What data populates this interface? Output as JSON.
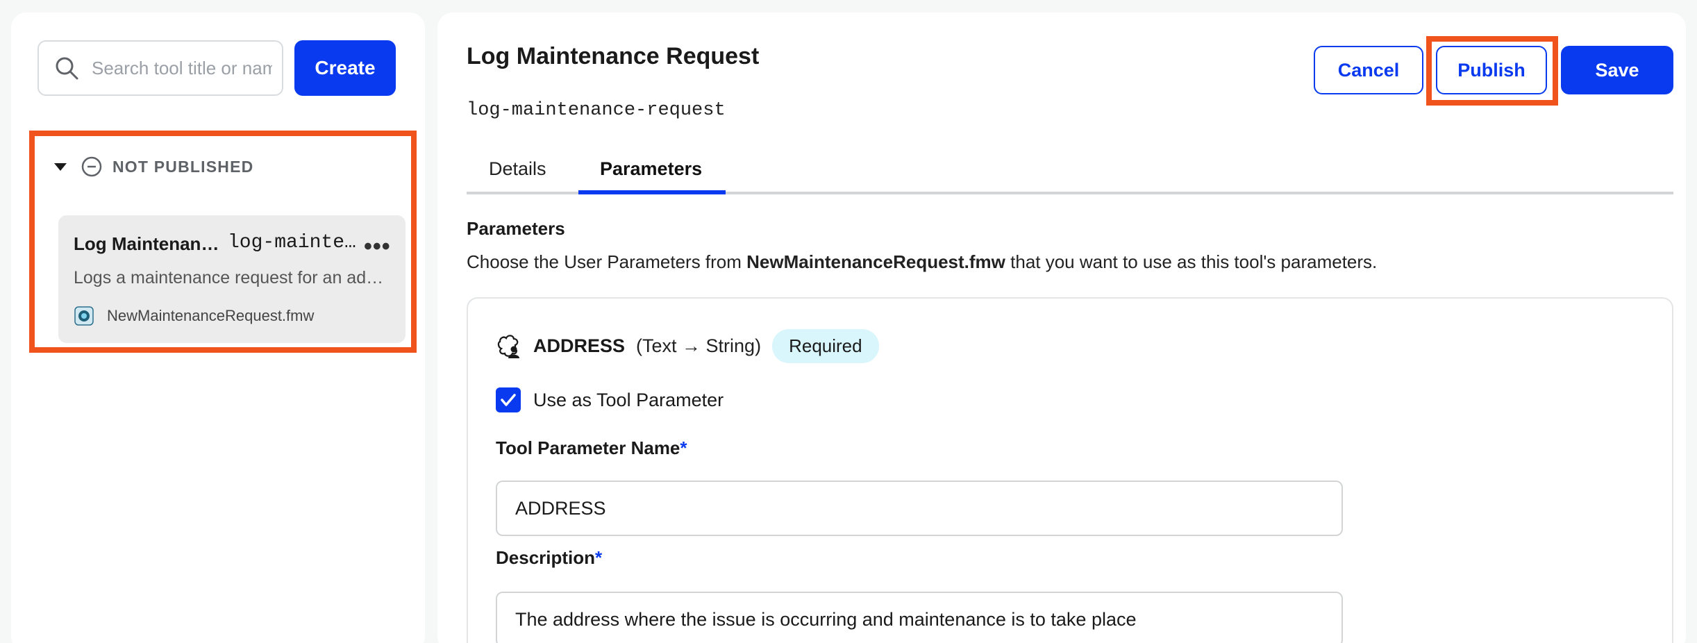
{
  "sidebar": {
    "search": {
      "placeholder": "Search tool title or name"
    },
    "create_label": "Create",
    "group": {
      "label": "NOT PUBLISHED",
      "items": [
        {
          "title": "Log Maintenance Request",
          "slug": "log-maintenance-request",
          "menu": "•••",
          "description": "Logs a maintenance request for an address",
          "file": "NewMaintenanceRequest.fmw"
        }
      ]
    }
  },
  "header": {
    "title": "Log Maintenance Request",
    "slug": "log-maintenance-request",
    "cancel_label": "Cancel",
    "publish_label": "Publish",
    "save_label": "Save"
  },
  "tabs": [
    {
      "label": "Details",
      "active": false
    },
    {
      "label": "Parameters",
      "active": true
    }
  ],
  "parameters_section": {
    "title": "Parameters",
    "desc_prefix": "Choose the User Parameters from ",
    "desc_file": "NewMaintenanceRequest.fmw",
    "desc_suffix": " that you want to use as this tool's parameters.",
    "params": [
      {
        "name": "ADDRESS",
        "type": "(Text → String)",
        "badge": "Required",
        "use_as_tool_label": "Use as Tool Parameter",
        "use_as_tool_checked": true,
        "tool_param_name_label": "Tool Parameter Name",
        "tool_param_name_value": "ADDRESS",
        "description_label": "Description",
        "description_value": "The address where the issue is occurring and maintenance is to take place",
        "required_mark": "*"
      }
    ]
  },
  "colors": {
    "accent": "#0a3af0",
    "highlight": "#f0531c",
    "badge_bg": "#d9f6fc"
  }
}
